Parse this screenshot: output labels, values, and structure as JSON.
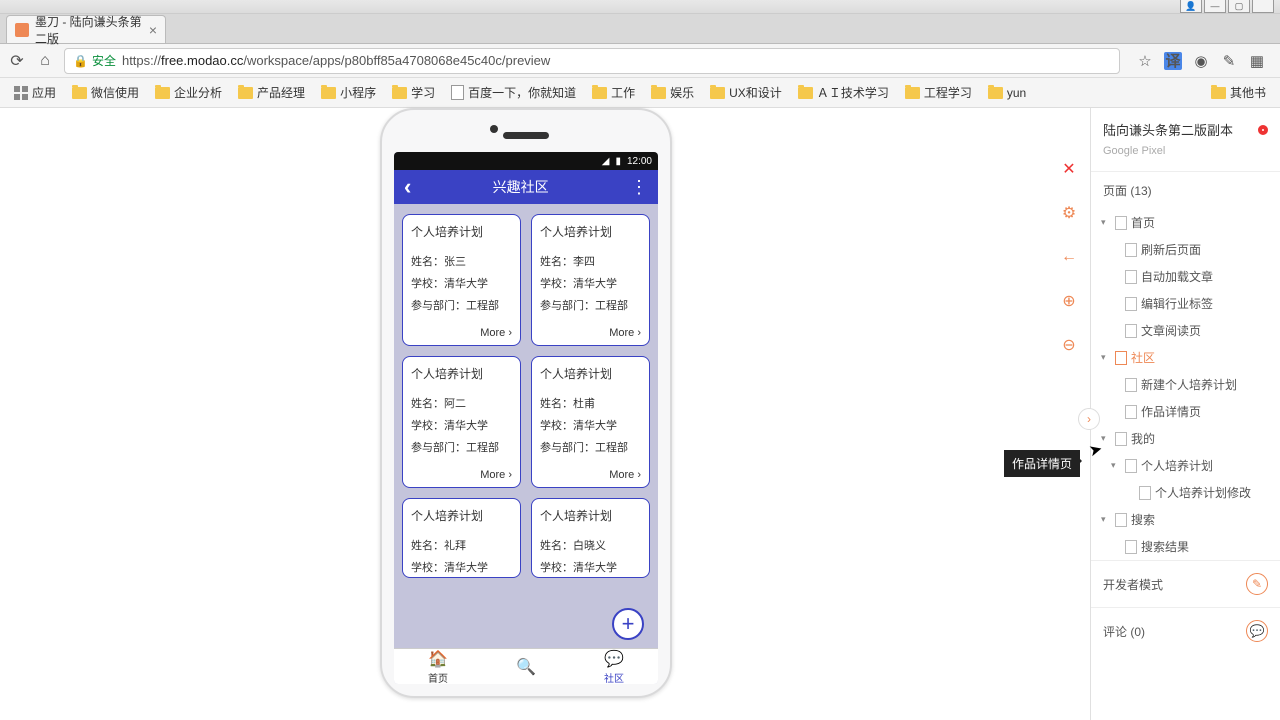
{
  "browser": {
    "tab_title": "墨刀 - 陆向谦头条第二版",
    "secure_label": "安全",
    "url_prefix": "https://",
    "url_host": "free.modao.cc",
    "url_path": "/workspace/apps/p80bff85a4708068e45c40c/preview",
    "bookmarks": [
      "应用",
      "微信使用",
      "企业分析",
      "产品经理",
      "小程序",
      "学习",
      "百度一下，你就知道",
      "工作",
      "娱乐",
      "UX和设计",
      "ＡＩ技术学习",
      "工程学习",
      "yun"
    ],
    "bookmark_overflow": "其他书"
  },
  "panel": {
    "project_name": "陆向谦头条第二版副本",
    "device": "Google Pixel",
    "pages_header": "页面 (13)",
    "tree": [
      {
        "label": "首页",
        "level": 0,
        "expandable": true
      },
      {
        "label": "刷新后页面",
        "level": 1
      },
      {
        "label": "自动加载文章",
        "level": 1
      },
      {
        "label": "编辑行业标签",
        "level": 1
      },
      {
        "label": "文章阅读页",
        "level": 1
      },
      {
        "label": "社区",
        "level": 0,
        "expandable": true,
        "active": true
      },
      {
        "label": "新建个人培养计划",
        "level": 1
      },
      {
        "label": "作品详情页",
        "level": 1
      },
      {
        "label": "我的",
        "level": 0,
        "expandable": true
      },
      {
        "label": "个人培养计划",
        "level": 1,
        "expandable": true
      },
      {
        "label": "个人培养计划修改",
        "level": 2
      },
      {
        "label": "搜索",
        "level": 0,
        "expandable": true
      },
      {
        "label": "搜索结果",
        "level": 1
      }
    ],
    "dev_mode": "开发者模式",
    "comments": "评论 (0)",
    "tooltip": "作品详情页"
  },
  "phone": {
    "time": "12:00",
    "header_title": "兴趣社区",
    "card_title": "个人培养计划",
    "more_label": "More",
    "name_label": "姓名：",
    "school_label": "学校：",
    "dept_label": "参与部门：",
    "school_val": "清华大学",
    "dept_val": "工程部",
    "cards": [
      {
        "name": "张三"
      },
      {
        "name": "李四"
      },
      {
        "name": "阿二"
      },
      {
        "name": "杜甫"
      },
      {
        "name": "礼拜"
      },
      {
        "name": "白晓义"
      }
    ],
    "tabs": {
      "home": "首页",
      "community": "社区"
    }
  }
}
